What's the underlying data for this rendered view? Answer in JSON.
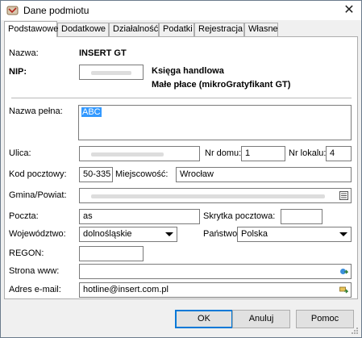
{
  "window": {
    "title": "Dane podmiotu",
    "close_glyph": "✕",
    "icon": "app-logo-icon"
  },
  "tabs": [
    {
      "label": "Podstawowe",
      "active": true
    },
    {
      "label": "Dodatkowe",
      "active": false
    },
    {
      "label": "Działalność",
      "active": false
    },
    {
      "label": "Podatki",
      "active": false
    },
    {
      "label": "Rejestracja",
      "active": false
    },
    {
      "label": "Własne",
      "active": false
    }
  ],
  "form": {
    "nazwa_label": "Nazwa:",
    "nazwa_value": "INSERT GT",
    "nip_label": "NIP:",
    "nip_value": "",
    "ksiega_text": "Księga handlowa",
    "male_place_text": "Małe płace (mikroGratyfikant GT)",
    "nazwa_pelna_label": "Nazwa pełna:",
    "nazwa_pelna_value": "ABC",
    "ulica_label": "Ulica:",
    "ulica_value": "",
    "nr_domu_label": "Nr domu:",
    "nr_domu_value": "1",
    "nr_lokalu_label": "Nr lokalu:",
    "nr_lokalu_value": "4",
    "kod_label": "Kod pocztowy:",
    "kod_value": "50-335",
    "miejscowosc_label": "Miejscowość:",
    "miejscowosc_value": "Wrocław",
    "gmina_label": "Gmina/Powiat:",
    "gmina_value": "",
    "poczta_label": "Poczta:",
    "poczta_value": "as",
    "skrytka_label": "Skrytka pocztowa:",
    "skrytka_value": "",
    "wojewodztwo_label": "Województwo:",
    "wojewodztwo_value": "dolnośląskie",
    "panstwo_label": "Państwo:",
    "panstwo_value": "Polska",
    "regon_label": "REGON:",
    "regon_value": "",
    "www_label": "Strona www:",
    "www_value": "",
    "email_label": "Adres e-mail:",
    "email_value": "hotline@insert.com.pl"
  },
  "buttons": {
    "ok": "OK",
    "cancel": "Anuluj",
    "help": "Pomoc"
  },
  "colors": {
    "selection": "#3399ff",
    "default_button_border": "#0078d7"
  }
}
